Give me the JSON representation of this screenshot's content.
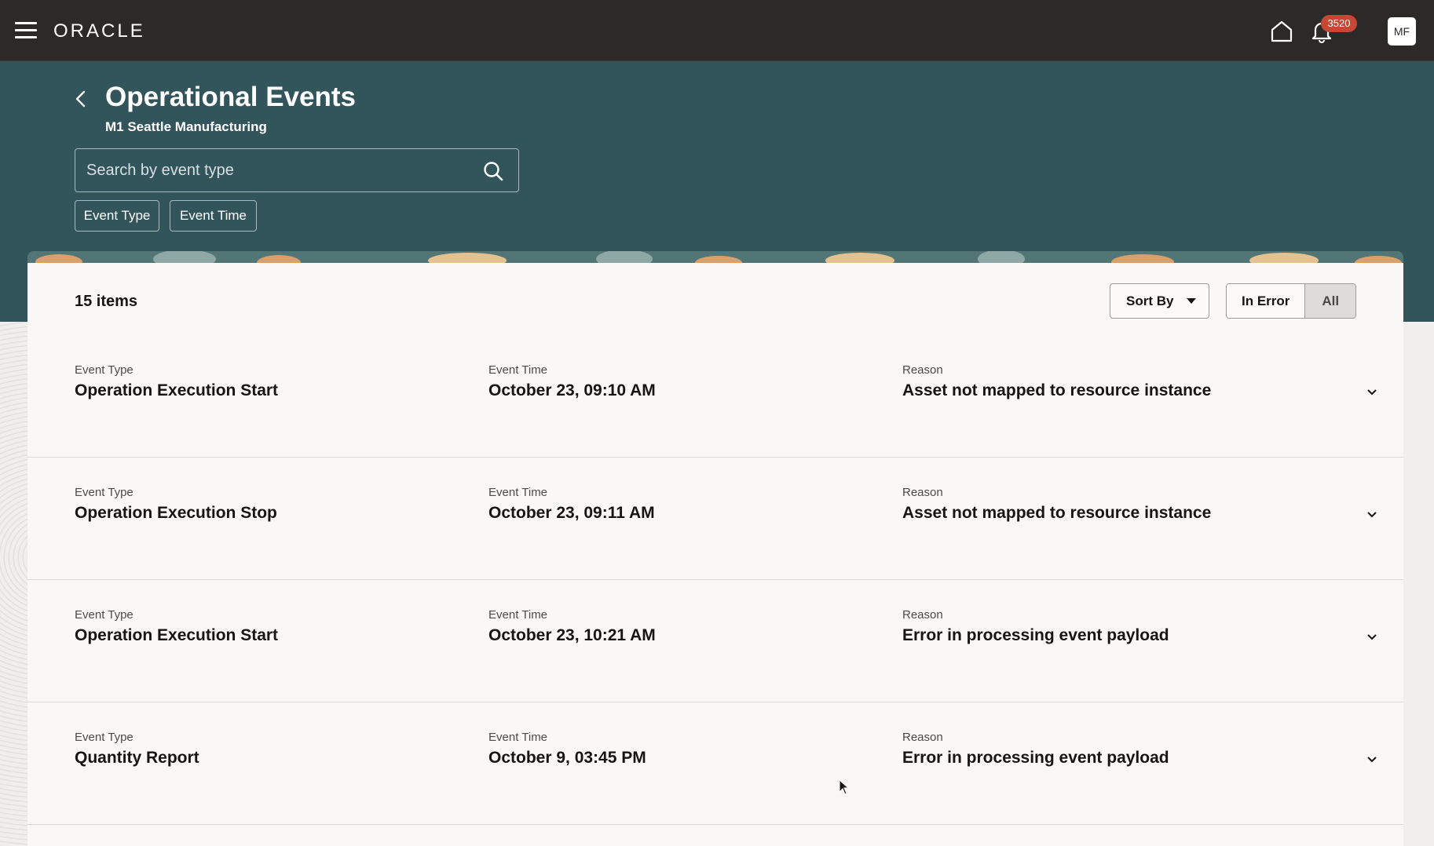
{
  "topbar": {
    "logo": "ORACLE",
    "notification_count": "3520",
    "user_initials": "MF",
    "icons": [
      "hamburger-menu-icon",
      "home-icon",
      "bell-icon"
    ]
  },
  "header": {
    "title": "Operational Events",
    "subtitle": "M1 Seattle Manufacturing",
    "search_placeholder": "Search by event type",
    "filters": [
      "Event Type",
      "Event Time"
    ]
  },
  "toolbar": {
    "count": "15 items",
    "sort_label": "Sort By",
    "segments": [
      "In Error",
      "All"
    ],
    "selected_segment": "All"
  },
  "labels": {
    "event_type": "Event Type",
    "event_time": "Event Time",
    "reason": "Reason"
  },
  "events": [
    {
      "type": "Operation Execution Start",
      "time": "October 23, 09:10 AM",
      "reason": "Asset not mapped to resource instance"
    },
    {
      "type": "Operation Execution Stop",
      "time": "October 23, 09:11 AM",
      "reason": "Asset not mapped to resource instance"
    },
    {
      "type": "Operation Execution Start",
      "time": "October 23, 10:21 AM",
      "reason": "Error in processing event payload"
    },
    {
      "type": "Quantity Report",
      "time": "October 9, 03:45 PM",
      "reason": "Error in processing event payload"
    }
  ],
  "colors": {
    "topbar": "#2b2a28",
    "header_band": "#32545b",
    "badge": "#c74634",
    "card": "#f9f8f7"
  }
}
